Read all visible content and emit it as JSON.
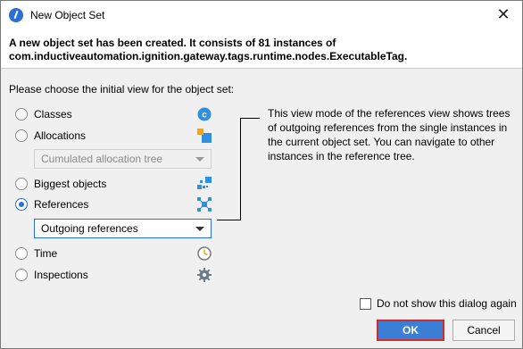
{
  "window": {
    "title": "New Object Set",
    "accent": "#2a6fd3"
  },
  "header": {
    "line1": "A new object set has been created. It consists of 81 instances of",
    "line2": "com.inductiveautomation.ignition.gateway.tags.runtime.nodes.ExecutableTag."
  },
  "prompt": "Please choose the initial view for the object set:",
  "options": [
    {
      "label": "Classes",
      "checked": false,
      "icon": "class-c-icon"
    },
    {
      "label": "Allocations",
      "checked": false,
      "icon": "allocations-icon"
    },
    {
      "label": "Biggest objects",
      "checked": false,
      "icon": "biggest-objects-icon"
    },
    {
      "label": "References",
      "checked": true,
      "icon": "references-icon"
    },
    {
      "label": "Time",
      "checked": false,
      "icon": "clock-icon"
    },
    {
      "label": "Inspections",
      "checked": false,
      "icon": "gear-icon"
    }
  ],
  "allocations_combo": {
    "value": "Cumulated allocation tree",
    "enabled": false
  },
  "references_combo": {
    "value": "Outgoing references",
    "enabled": true
  },
  "description": "This view mode of the references view shows trees of outgoing references from the single instances in the current object set. You can navigate to other instances in the reference tree.",
  "footer": {
    "dont_show_label": "Do not show this dialog again",
    "dont_show_checked": false,
    "ok_label": "OK",
    "cancel_label": "Cancel"
  },
  "colors": {
    "ok_highlight": "#d62b2b",
    "ok_fill": "#3a7fd5"
  }
}
